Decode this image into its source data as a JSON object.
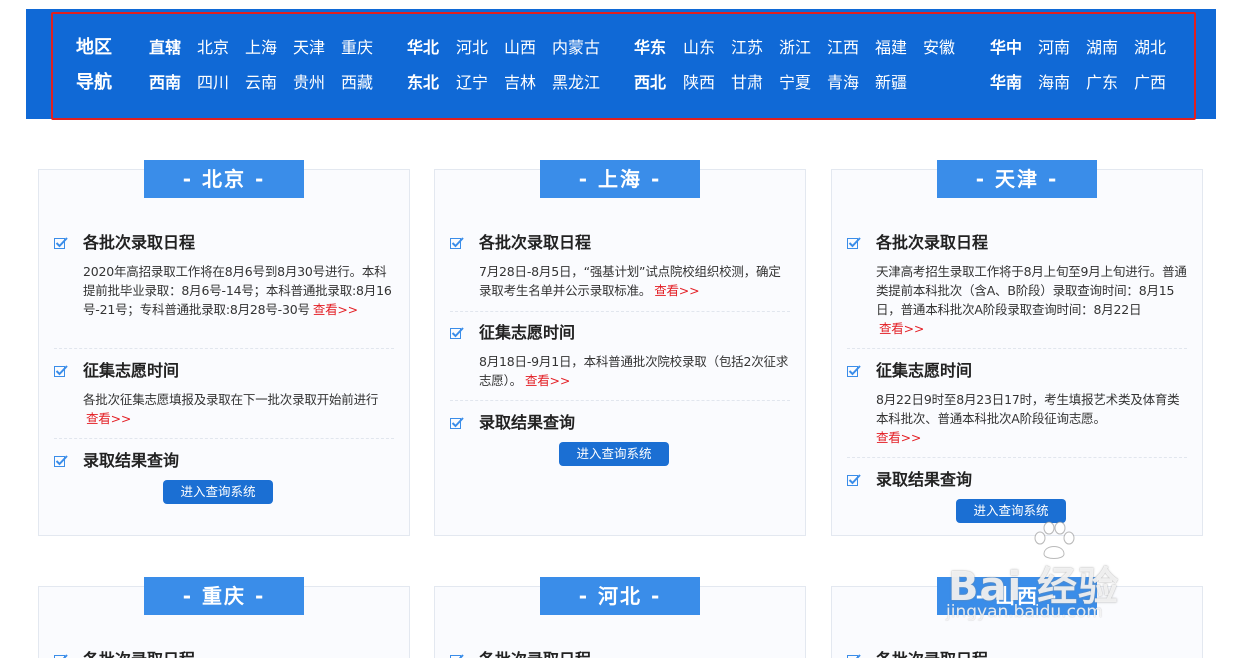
{
  "nav": {
    "title_line1": "地区",
    "title_line2": "导航",
    "groups": [
      {
        "name": "直辖",
        "items": [
          "北京",
          "上海",
          "天津",
          "重庆"
        ]
      },
      {
        "name": "华北",
        "items": [
          "河北",
          "山西",
          "内蒙古"
        ]
      },
      {
        "name": "华东",
        "items": [
          "山东",
          "江苏",
          "浙江",
          "江西",
          "福建",
          "安徽"
        ]
      },
      {
        "name": "华中",
        "items": [
          "河南",
          "湖南",
          "湖北"
        ]
      },
      {
        "name": "西南",
        "items": [
          "四川",
          "云南",
          "贵州",
          "西藏"
        ]
      },
      {
        "name": "东北",
        "items": [
          "辽宁",
          "吉林",
          "黑龙江"
        ]
      },
      {
        "name": "西北",
        "items": [
          "陕西",
          "甘肃",
          "宁夏",
          "青海",
          "新疆"
        ]
      },
      {
        "name": "华南",
        "items": [
          "海南",
          "广东",
          "广西"
        ]
      }
    ]
  },
  "labels": {
    "schedule": "各批次录取日程",
    "supplement": "征集志愿时间",
    "result": "录取结果查询",
    "more": "查看>>",
    "query_button": "进入查询系统"
  },
  "cards": [
    {
      "title": "- 北京 -",
      "schedule_text": "2020年高招录取工作将在8月6号到8月30号进行。本科提前批毕业录取：8月6号-14号；本科普通批录取:8月16号-21号；专科普通批录取:8月28号-30号",
      "supplement_text": "各批次征集志愿填报及录取在下一批次录取开始前进行"
    },
    {
      "title": "- 上海 -",
      "schedule_text": "7月28日-8月5日，“强基计划”试点院校组织校测，确定录取考生名单并公示录取标准。",
      "supplement_text": "8月18日-9月1日，本科普通批次院校录取（包括2次征求志愿）。"
    },
    {
      "title": "- 天津 -",
      "schedule_text": "天津高考招生录取工作将于8月上旬至9月上旬进行。普通类提前本科批次（含A、B阶段）录取查询时间：8月15日，普通本科批次A阶段录取查询时间：8月22日",
      "supplement_text": "8月22日9时至8月23日17时，考生填报艺术类及体育类本科批次、普通本科批次A阶段征询志愿。"
    },
    {
      "title": "- 重庆 -"
    },
    {
      "title": "- 河北 -"
    },
    {
      "title": "- 山西 -"
    }
  ],
  "watermark": {
    "brand": "Bai 经验",
    "site": "jingyan.baidu.com"
  },
  "colors": {
    "nav_bg": "#1069d6",
    "card_title_bg": "#3a8de9",
    "button_bg": "#1b6fd3",
    "more_link": "#e31e24",
    "highlight_outline": "#e02020"
  }
}
